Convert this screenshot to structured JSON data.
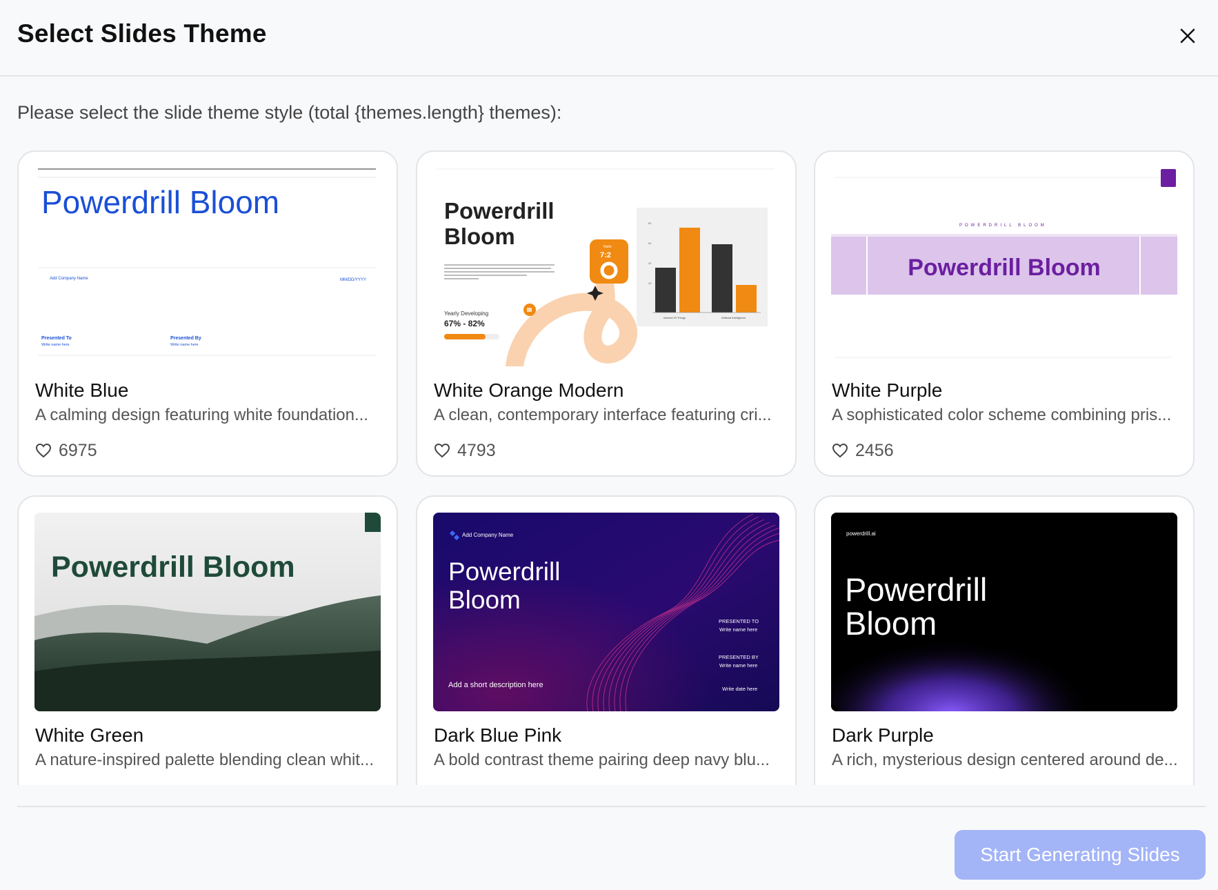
{
  "dialog": {
    "title": "Select Slides Theme",
    "subtitle": "Please select the slide theme style (total {themes.length} themes):",
    "start_button": "Start Generating Slides"
  },
  "colors": {
    "accent_button": "#a3b4f7",
    "white_blue": "#1a4fd6",
    "white_orange": "#f08a12",
    "white_purple": "#6b1fa0",
    "white_green": "#1f4a3a",
    "dark_blue_pink": "#1a0a5e",
    "dark_purple": "#7a4dff"
  },
  "themes": [
    {
      "name": "White Blue",
      "description": "A calming design featuring white foundation...",
      "likes": "6975",
      "preview": {
        "title": "Powerdrill Bloom",
        "company": "Add Company Name",
        "date": "MM/DD/YYYY",
        "presented_to": "Presented To",
        "presented_by": "Presented By",
        "name_placeholder": "Write name here"
      }
    },
    {
      "name": "White Orange Modern",
      "description": "A clean, contemporary interface featuring cri...",
      "likes": "4793",
      "preview": {
        "title_line1": "Powerdrill",
        "title_line2": "Bloom",
        "ratio": "7:2",
        "ratio_label": "Ratio",
        "stat_label": "Yearly Developing",
        "stat_value": "67% - 82%",
        "chart_x1": "Internet Of Things",
        "chart_x2": "Artificial Intelligence",
        "chart_y": [
          "80",
          "60",
          "40",
          "20"
        ],
        "body_text": "Describe how to monetize, who your customers are, distribution channels, or fee structure. The goal is to get an idea of how this business will survive with your product or service and tell how your company will make money and achieve its goals."
      }
    },
    {
      "name": "White Purple",
      "description": "A sophisticated color scheme combining pris...",
      "likes": "2456",
      "preview": {
        "kicker": "POWERDRILL BLOOM",
        "title": "Powerdrill Bloom"
      }
    },
    {
      "name": "White Green",
      "description": "A nature-inspired palette blending clean whit...",
      "preview": {
        "title": "Powerdrill Bloom"
      }
    },
    {
      "name": "Dark Blue Pink",
      "description": "A bold contrast theme pairing deep navy blu...",
      "preview": {
        "company": "Add Company Name",
        "title_line1": "Powerdrill",
        "title_line2": "Bloom",
        "presented_to": "PRESENTED TO",
        "presented_by": "PRESENTED BY",
        "name_placeholder": "Write name here",
        "description": "Add a short description here",
        "date": "Write date here"
      }
    },
    {
      "name": "Dark Purple",
      "description": "A rich, mysterious design centered around de...",
      "preview": {
        "brand": "powerdrill.ai",
        "title_line1": "Powerdrill",
        "title_line2": "Bloom"
      }
    }
  ]
}
